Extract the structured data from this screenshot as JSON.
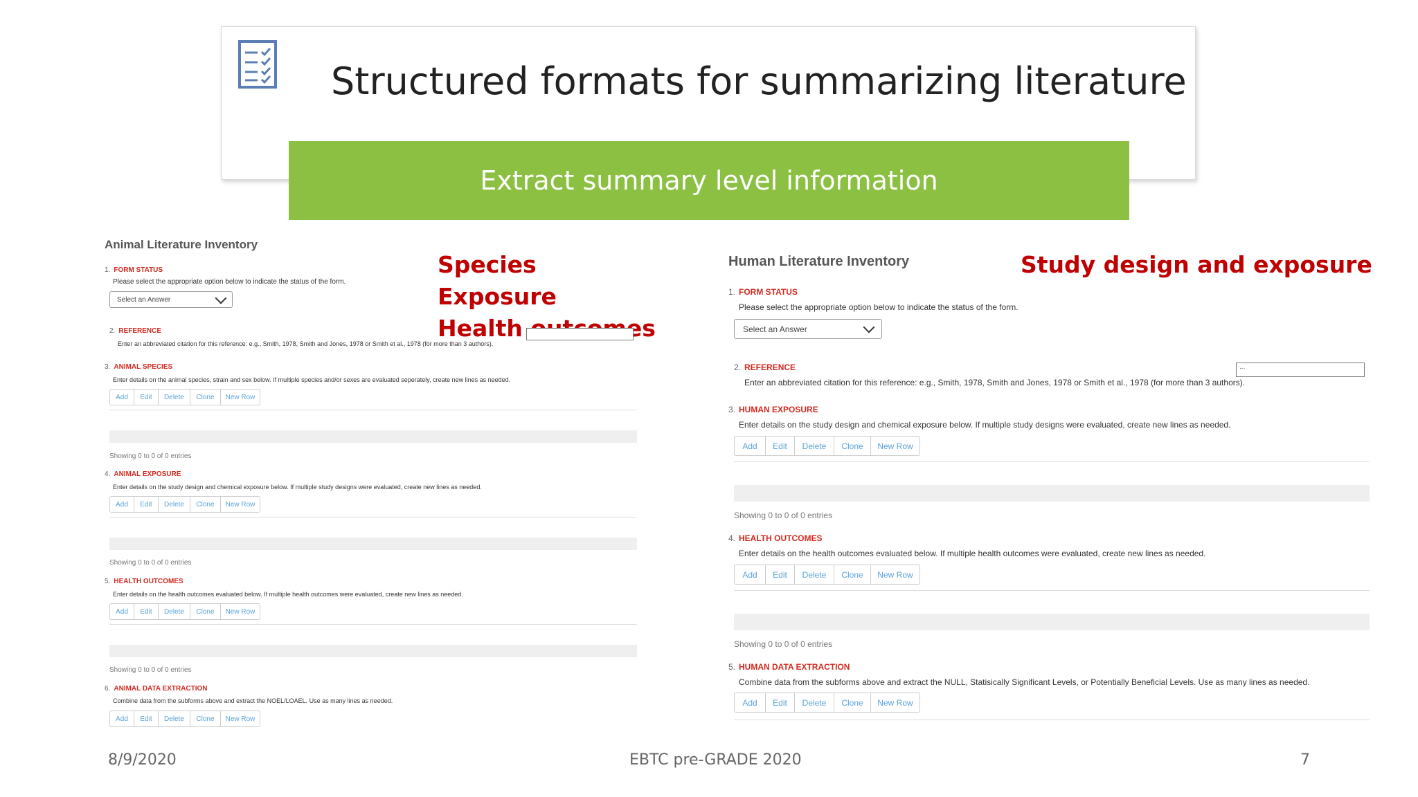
{
  "slide": {
    "title": "Structured formats for summarizing literature",
    "banner": "Extract summary level information",
    "icon": "checklist-icon"
  },
  "callouts": {
    "animal": [
      "Species",
      "Exposure",
      "Health outcomes"
    ],
    "human": "Study design and exposure"
  },
  "buttons": [
    "Add",
    "Edit",
    "Delete",
    "Clone",
    "New Row"
  ],
  "animal": {
    "title": "Animal Literature Inventory",
    "form_status": {
      "num": "1.",
      "label": "FORM STATUS",
      "desc": "Please select the appropriate option below to indicate the status of the form.",
      "select": "Select an Answer"
    },
    "reference": {
      "num": "2.",
      "label": "REFERENCE",
      "desc": "Enter an abbreviated citation for this reference: e.g., Smith, 1978, Smith and Jones, 1978 or Smith et al., 1978 (for more than 3 authors)."
    },
    "species": {
      "num": "3.",
      "label": "ANIMAL SPECIES",
      "desc": "Enter details on the animal species, strain and sex below. If multiple species and/or sexes are evaluated seperately, create new lines as needed.",
      "showing": "Showing 0 to 0 of 0 entries"
    },
    "exposure": {
      "num": "4.",
      "label": "ANIMAL EXPOSURE",
      "desc": "Enter details on the study design and chemical exposure below. If multiple study designs were evaluated, create new lines as needed.",
      "showing": "Showing 0 to 0 of 0 entries"
    },
    "outcomes": {
      "num": "5.",
      "label": "HEALTH OUTCOMES",
      "desc": "Enter details on the health outcomes evaluated below. If multiple health outcomes were evaluated, create new lines as needed.",
      "showing": "Showing 0 to 0 of 0 entries"
    },
    "extraction": {
      "num": "6.",
      "label": "ANIMAL DATA EXTRACTION",
      "desc": "Combine data from the subforms above and extract the NOEL/LOAEL. Use as many lines as needed."
    }
  },
  "human": {
    "title": "Human Literature Inventory",
    "form_status": {
      "num": "1.",
      "label": "FORM STATUS",
      "desc": "Please select the appropriate option below to indicate the status of the form.",
      "select": "Select an Answer"
    },
    "reference": {
      "num": "2.",
      "label": "REFERENCE",
      "desc": "Enter an abbreviated citation for this reference: e.g., Smith, 1978, Smith and Jones, 1978 or Smith et al., 1978 (for more than 3 authors).",
      "input_value": "..."
    },
    "exposure": {
      "num": "3.",
      "label": "HUMAN EXPOSURE",
      "desc": "Enter details on the study design and chemical exposure below. If multiple study designs were evaluated, create new lines as needed.",
      "showing": "Showing 0 to 0 of 0 entries"
    },
    "outcomes": {
      "num": "4.",
      "label": "HEALTH OUTCOMES",
      "desc": "Enter details on the health outcomes evaluated below. If multiple health outcomes were evaluated, create new lines as needed.",
      "showing": "Showing 0 to 0 of 0 entries"
    },
    "extraction": {
      "num": "5.",
      "label": "HUMAN DATA EXTRACTION",
      "desc": "Combine data from the subforms above and extract the NULL, Statisically Significant Levels, or Potentially Beneficial Levels. Use as many lines as needed."
    }
  },
  "footer": {
    "date": "8/9/2020",
    "event": "EBTC pre-GRADE 2020",
    "page": "7"
  },
  "colors": {
    "banner": "#8bc042",
    "callout": "#c00000",
    "section_label": "#d32a20",
    "button_text": "#5aa3d8"
  }
}
